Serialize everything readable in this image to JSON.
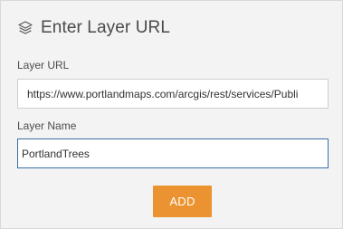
{
  "header": {
    "title": "Enter Layer URL",
    "icon": "layers-icon"
  },
  "form": {
    "url_label": "Layer URL",
    "url_value": "https://www.portlandmaps.com/arcgis/rest/services/Publi",
    "name_label": "Layer Name",
    "name_value": "PortlandTrees",
    "add_label": "ADD"
  },
  "colors": {
    "background": "#f3f3f3",
    "accent_button": "#ec9331",
    "focused_border": "#3a6ea8"
  }
}
